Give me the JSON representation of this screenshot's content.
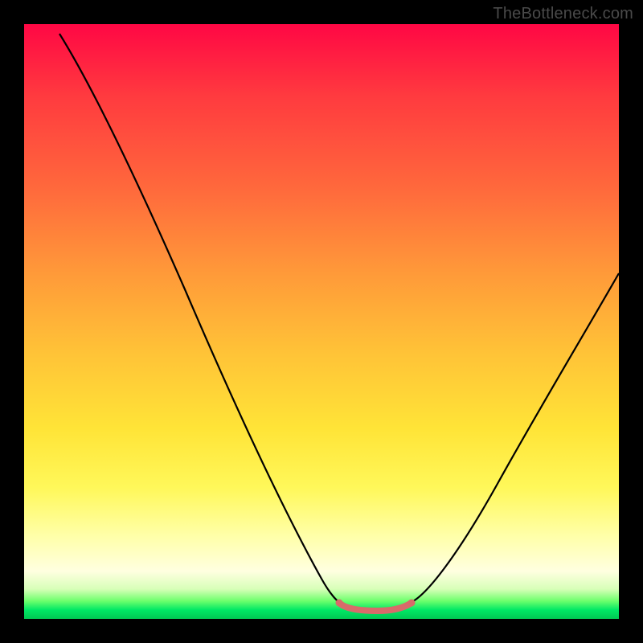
{
  "watermark": "TheBottleneck.com",
  "chart_data": {
    "type": "line",
    "title": "",
    "xlabel": "",
    "ylabel": "",
    "xlim": [
      0,
      100
    ],
    "ylim": [
      0,
      100
    ],
    "series": [
      {
        "name": "left-branch",
        "x": [
          6,
          10,
          15,
          20,
          25,
          30,
          35,
          40,
          45,
          50,
          53
        ],
        "values": [
          98,
          92,
          84,
          76,
          67,
          58,
          48,
          37,
          25,
          11,
          3
        ]
      },
      {
        "name": "right-branch",
        "x": [
          65,
          68,
          72,
          76,
          80,
          84,
          88,
          92,
          96,
          100
        ],
        "values": [
          3,
          7,
          13,
          20,
          27,
          33,
          40,
          46,
          52,
          58
        ]
      },
      {
        "name": "bottom-flat-highlight",
        "x": [
          53,
          55,
          57,
          59,
          61,
          63,
          65
        ],
        "values": [
          3,
          2,
          2,
          2,
          2,
          2,
          3
        ]
      }
    ],
    "colors": {
      "curve": "#000000",
      "flat_highlight": "#d86a6a",
      "gradient_top": "#ff0744",
      "gradient_bottom": "#00c853"
    }
  }
}
